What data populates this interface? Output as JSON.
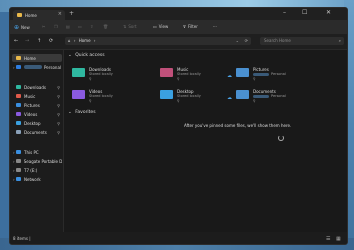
{
  "window": {
    "tab_title": "Home",
    "tab_close": "×",
    "new_tab": "+",
    "minimize": "–",
    "maximize": "☐",
    "close": "✕"
  },
  "toolbar": {
    "new_label": "New",
    "sort_label": "Sort",
    "view_label": "View",
    "filter_label": "Filter",
    "more": "···"
  },
  "nav": {
    "back": "←",
    "forward": "→",
    "up": "↑",
    "refresh": "⟳",
    "address": "Home",
    "address_chevron": "›",
    "search_placeholder": "Search Home"
  },
  "sidebar": {
    "items": [
      {
        "label": "Home",
        "color": "#e8b84a",
        "selected": true
      },
      {
        "label": "Personal",
        "color": "#2e7de0"
      },
      {
        "label": "Downloads",
        "color": "#2fb8a0",
        "pin": "📌"
      },
      {
        "label": "Music",
        "color": "#e05a4a",
        "pin": "📌"
      },
      {
        "label": "Pictures",
        "color": "#3a8fe0",
        "pin": "📌"
      },
      {
        "label": "Videos",
        "color": "#8a5ae0",
        "pin": "📌"
      },
      {
        "label": "Desktop",
        "color": "#3aa0e0",
        "pin": "📌"
      },
      {
        "label": "Documents",
        "color": "#8aa0b8",
        "pin": "📌"
      },
      {
        "label": "This PC",
        "color": "#3a8fe0"
      },
      {
        "label": "Seagate Portable Dr",
        "color": "#888888"
      },
      {
        "label": "T7 (E:)",
        "color": "#888888"
      },
      {
        "label": "Network",
        "color": "#3a8fe0"
      }
    ]
  },
  "quick_access": {
    "heading": "Quick access",
    "items": [
      {
        "name": "Downloads",
        "sub": "Stored locally",
        "color": "#2fb8a0"
      },
      {
        "name": "Music",
        "sub": "Stored locally",
        "color": "#c0507a"
      },
      {
        "name": "Pictures",
        "sub": "Personal",
        "color": "#4a90d0"
      },
      {
        "name": "Videos",
        "sub": "Stored locally",
        "color": "#8a5ae0"
      },
      {
        "name": "Desktop",
        "sub": "Stored locally",
        "color": "#3aa0e0"
      },
      {
        "name": "Documents",
        "sub": "Personal",
        "color": "#4a90d0"
      }
    ]
  },
  "favorites": {
    "heading": "Favorites",
    "empty_message": "After you've pinned some files, we'll show them here."
  },
  "status": {
    "text": "8 items  |"
  }
}
